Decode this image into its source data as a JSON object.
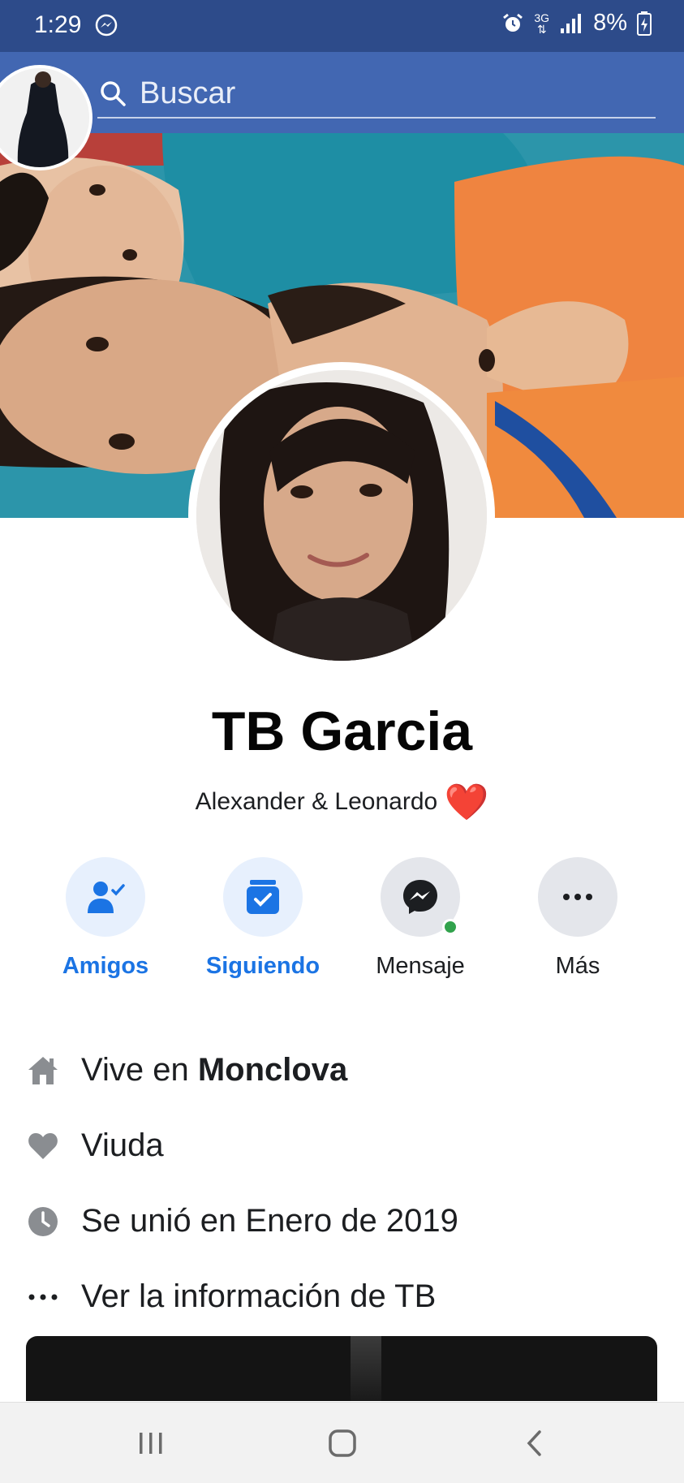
{
  "status_bar": {
    "time": "1:29",
    "network": "3G",
    "battery": "8%",
    "icons": [
      "messenger-icon",
      "alarm-icon",
      "network-icon",
      "signal-icon",
      "battery-icon"
    ]
  },
  "search": {
    "placeholder": "Buscar"
  },
  "profile": {
    "name": "TB Garcia",
    "bio": "Alexander & Leonardo",
    "bio_emoji": "❤️"
  },
  "actions": [
    {
      "label": "Amigos",
      "icon": "friends-icon",
      "color": "#1b74e4"
    },
    {
      "label": "Siguiendo",
      "icon": "following-icon",
      "color": "#1b74e4"
    },
    {
      "label": "Mensaje",
      "icon": "messenger-icon",
      "online": true
    },
    {
      "label": "Más",
      "icon": "more-icon"
    }
  ],
  "info": {
    "lives_prefix": "Vive en",
    "lives_city": "Monclova",
    "relationship": "Viuda",
    "joined": "Se unió en Enero de 2019",
    "see_more": "Ver la información de TB"
  },
  "colors": {
    "status_bar": "#2d4b8a",
    "header": "#4267b2",
    "accent": "#1b74e4",
    "online": "#31a24c"
  },
  "nav": [
    "recent-apps-icon",
    "home-icon",
    "back-icon"
  ]
}
